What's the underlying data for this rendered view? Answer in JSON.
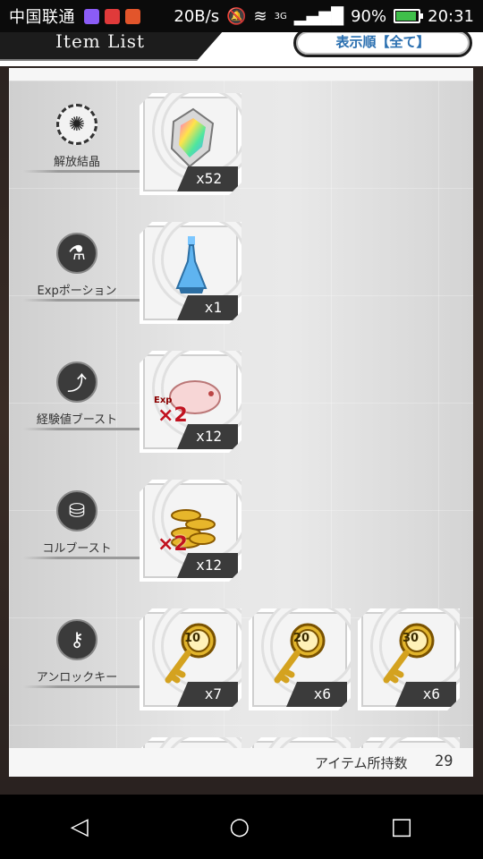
{
  "status": {
    "carrier": "中国联通",
    "speed": "20B/s",
    "network": "3G",
    "battery": "90%",
    "battery_level": 0.9,
    "time": "20:31"
  },
  "header": {
    "title": "Item List",
    "sort_button": "表示順【全て】"
  },
  "categories": [
    {
      "name": "解放結晶",
      "icon": "crystal-gear-icon",
      "items": [
        {
          "count": "x52",
          "art": "rainbow-crystal"
        }
      ]
    },
    {
      "name": "Expポーション",
      "icon": "flask-icon",
      "items": [
        {
          "count": "x1",
          "art": "blue-potion"
        }
      ]
    },
    {
      "name": "経験値ブースト",
      "icon": "exp-boost-icon",
      "items": [
        {
          "count": "x12",
          "art": "pig-exp-x2",
          "badge": "Exp",
          "multiplier": "×2"
        }
      ]
    },
    {
      "name": "コルブースト",
      "icon": "coin-boost-icon",
      "items": [
        {
          "count": "x12",
          "art": "gold-coins-x2",
          "multiplier": "×2"
        }
      ]
    },
    {
      "name": "アンロックキー",
      "icon": "key-icon",
      "items": [
        {
          "count": "x7",
          "art": "gold-key",
          "key_number": "10"
        },
        {
          "count": "x6",
          "art": "gold-key",
          "key_number": "20"
        },
        {
          "count": "x6",
          "art": "gold-key",
          "key_number": "30"
        }
      ]
    }
  ],
  "footer": {
    "label": "アイテム所持数",
    "value": "29"
  },
  "colors": {
    "sort_text": "#2a6fb0",
    "count_bg": "#3b3b3b",
    "battery": "#3fbf4a"
  },
  "nav": {
    "back": "◁",
    "home": "○",
    "recents": "□"
  }
}
